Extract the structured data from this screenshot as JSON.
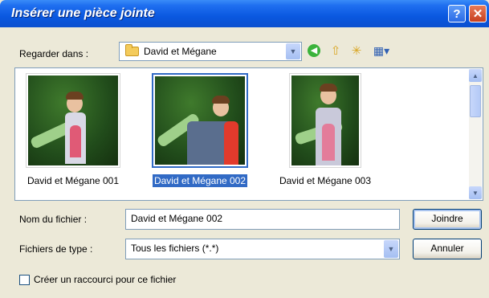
{
  "window": {
    "title": "Insérer une pièce jointe",
    "help": "?",
    "close": "✕"
  },
  "lookin": {
    "label": "Regarder dans :",
    "value": "David et Mégane"
  },
  "files": [
    {
      "name": "David et Mégane 001",
      "selected": false
    },
    {
      "name": "David et Mégane 002",
      "selected": true
    },
    {
      "name": "David et Mégane 003",
      "selected": false
    }
  ],
  "filename": {
    "label": "Nom du fichier :",
    "value": "David et Mégane 002"
  },
  "filetype": {
    "label": "Fichiers de type :",
    "value": "Tous les fichiers (*.*)"
  },
  "buttons": {
    "open": "Joindre",
    "cancel": "Annuler"
  },
  "shortcut": {
    "label": "Créer un raccourci pour ce fichier",
    "checked": false
  },
  "icons": {
    "back": "green-back-icon",
    "up": "up-folder-icon",
    "new_folder": "new-folder-icon",
    "views": "views-menu-icon",
    "folder": "folder-icon"
  }
}
